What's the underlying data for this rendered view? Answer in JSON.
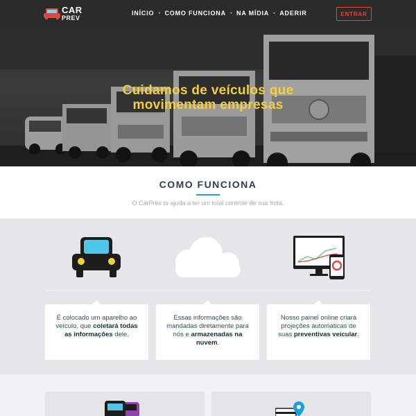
{
  "header": {
    "logo_line1": "CAR",
    "logo_line2": "PREV",
    "nav": [
      "INÍCIO",
      "COMO FUNCIONA",
      "NA MÍDIA",
      "ADERIR"
    ],
    "login_label": "ENTRAR"
  },
  "hero": {
    "title_line1": "Cuidamos de veículos que",
    "title_line2": "movimentam empresas"
  },
  "how": {
    "title": "COMO FUNCIONA",
    "subtitle": "O CarPrev te ajuda a ter um total controle de sua frota."
  },
  "cards": [
    {
      "pre": "É colocado um aparelho ao veículo, que ",
      "bold": "coletará todas as informações",
      "post": " dele."
    },
    {
      "pre": "Essas informações são mandadas diretamente para nós e ",
      "bold": "armazenadas na nuvem",
      "post": "."
    },
    {
      "pre": "Nosso painel online criará projeções automáticas de suas ",
      "bold": "preventivas veícular",
      "post": "."
    }
  ],
  "icons": {
    "logo": "car-icon",
    "feature1": "car-icon",
    "feature2": "cloud-icon",
    "feature3": "dashboard-monitor-icon",
    "bottom1": "cars-icon",
    "bottom2": "location-card-icon"
  },
  "colors": {
    "header_bg": "#2b2b2b",
    "accent_red": "#e2453b",
    "hero_title": "#f4d03f",
    "section_title": "#2c3e50",
    "underline": "#1e9fd8",
    "features_bg": "#e4e6e8"
  }
}
